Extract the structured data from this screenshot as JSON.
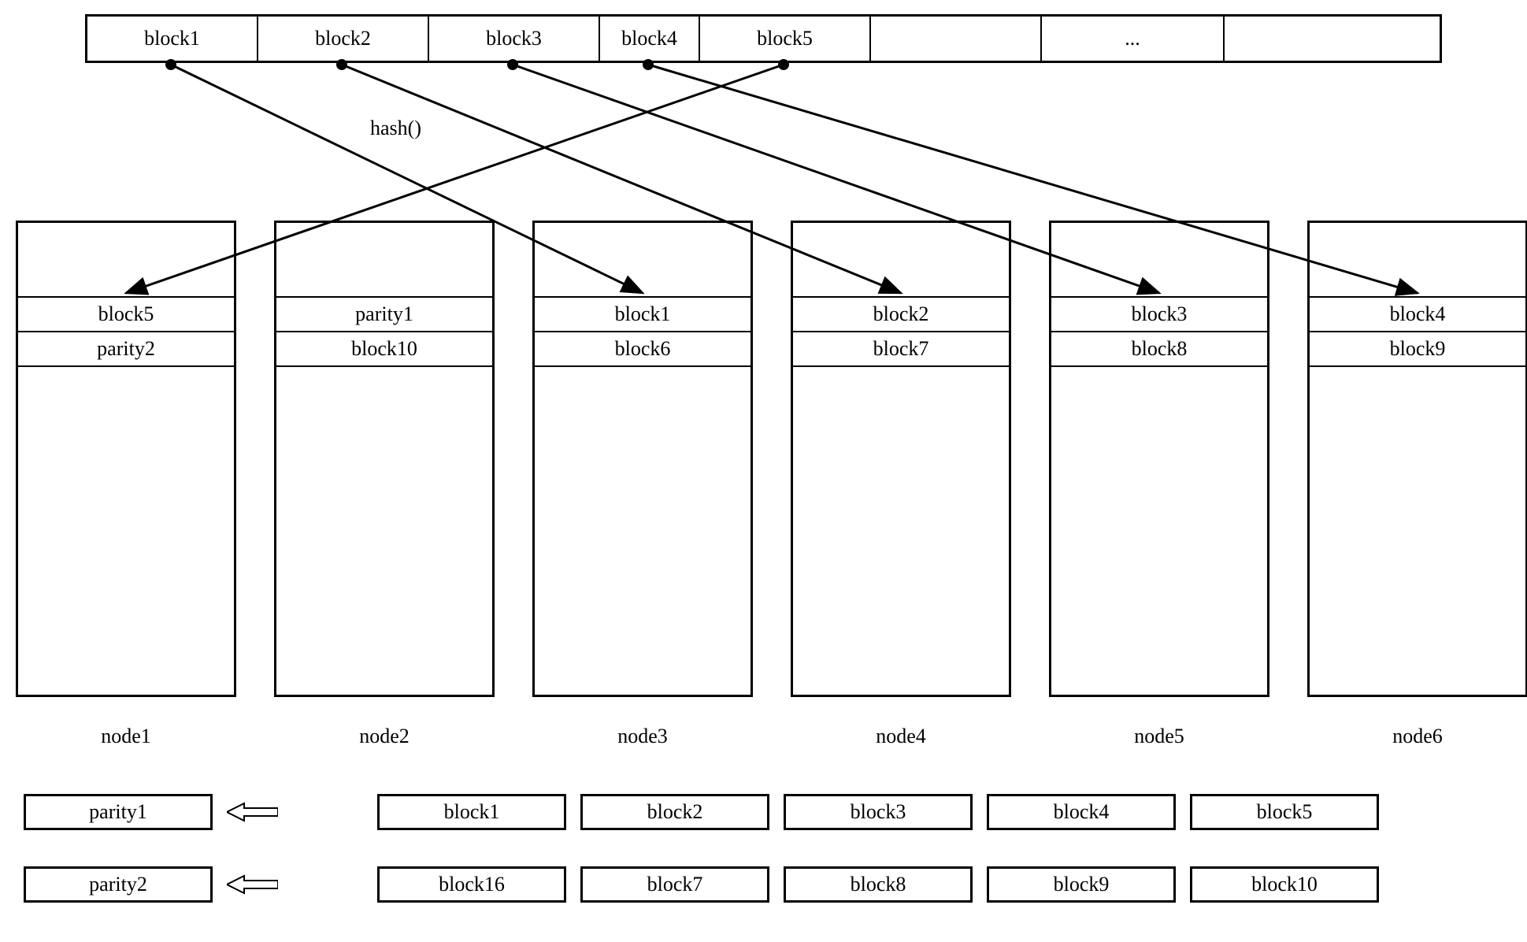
{
  "top_blocks": {
    "b1": "block1",
    "b2": "block2",
    "b3": "block3",
    "b4": "block4",
    "b5": "block5",
    "ellipsis": "..."
  },
  "hash_label": "hash()",
  "nodes": {
    "n1": {
      "label": "node1",
      "slot1": "block5",
      "slot2": "parity2"
    },
    "n2": {
      "label": "node2",
      "slot1": "parity1",
      "slot2": "block10"
    },
    "n3": {
      "label": "node3",
      "slot1": "block1",
      "slot2": "block6"
    },
    "n4": {
      "label": "node4",
      "slot1": "block2",
      "slot2": "block7"
    },
    "n5": {
      "label": "node5",
      "slot1": "block3",
      "slot2": "block8"
    },
    "n6": {
      "label": "node6",
      "slot1": "block4",
      "slot2": "block9"
    }
  },
  "parity_rows": {
    "r1": {
      "parity": "parity1",
      "b1": "block1",
      "b2": "block2",
      "b3": "block3",
      "b4": "block4",
      "b5": "block5"
    },
    "r2": {
      "parity": "parity2",
      "b1": "block16",
      "b2": "block7",
      "b3": "block8",
      "b4": "block9",
      "b5": "block10"
    }
  }
}
